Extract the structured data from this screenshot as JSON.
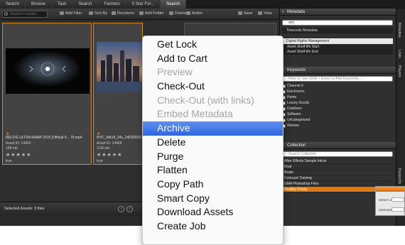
{
  "tabs": [
    "Search",
    "Browse",
    "Task",
    "Search",
    "Farmers",
    "5 Star For...",
    "Search"
  ],
  "active_tab_index": 6,
  "toolbar": {
    "search_placeholder": "Search in results...",
    "add_filter": "Add Filter",
    "sort_by": "Sort By",
    "revisions": "Revisions",
    "add_folder": "Add Folder",
    "delete": "Delete",
    "action": "Action",
    "save": "Save",
    "view": "View"
  },
  "assets": [
    {
      "title": "RELIVE ULTRA MIAMI 2015 [Official 4....79.mp4",
      "asset_id": "Asset ID: 14469",
      "size": "168 mb",
      "rating": "★★★★★",
      "flag": "true",
      "selected": true
    },
    {
      "title": "NYC_Wk18_24s_24032016-01",
      "asset_id": "Asset ID: 14468",
      "size": "2.68 mb",
      "rating": "★★★★★",
      "flag": "true",
      "selected": true
    }
  ],
  "status": {
    "selected": "Selected Assets: 3 files"
  },
  "metadata_panel": {
    "header": "Metadata",
    "search_value": "sho",
    "timecode": "Timecode Metadata",
    "drm": "Digital Rights Management",
    "drm_rows": [
      "Asset Shelf-life Start",
      "Asset Shelf-life End"
    ]
  },
  "keywords_panel": {
    "header": "Keywords",
    "placeholder": "Filter or Use (Shift + Enter) to Add Keywords...",
    "items": [
      "Channel 9",
      "Electronics",
      "Home",
      "Luxury Goods",
      "Outdoors",
      "Software",
      "Uncategorized",
      "Women"
    ]
  },
  "collection_panel": {
    "header": "Collection",
    "placeholder": "Search Collection",
    "items": [
      "After Effects Sample Intros",
      "Boat",
      "Boats",
      "Comcast Training",
      "GMA Photoshop Files",
      "Healthy Drinks"
    ],
    "highlight_index": 5
  },
  "side_strip": [
    "Metadata",
    "Links",
    "Players",
    "Keywords"
  ],
  "login_popup": {
    "server_label": "Server Url",
    "user_label": "Username"
  },
  "context_menu": {
    "items": [
      {
        "label": "Get Lock",
        "disabled": false
      },
      {
        "label": "Add to Cart",
        "disabled": false
      },
      {
        "label": "Preview",
        "disabled": true
      },
      {
        "label": "Check-Out",
        "disabled": false
      },
      {
        "label": "Check-Out (with links)",
        "disabled": true
      },
      {
        "label": "Embed Metadata",
        "disabled": true
      },
      {
        "label": "Archive",
        "disabled": false,
        "highlighted": true
      },
      {
        "label": "Delete",
        "disabled": false
      },
      {
        "label": "Purge",
        "disabled": false
      },
      {
        "label": "Flatten",
        "disabled": false
      },
      {
        "label": "Copy Path",
        "disabled": false
      },
      {
        "label": "Smart Copy",
        "disabled": false
      },
      {
        "label": "Download Assets",
        "disabled": false
      },
      {
        "label": "Create Job",
        "disabled": false
      }
    ]
  },
  "colors": {
    "accent": "#d78a1e",
    "menu_highlight": "#2f66e0",
    "collection_highlight": "#e07a10"
  }
}
